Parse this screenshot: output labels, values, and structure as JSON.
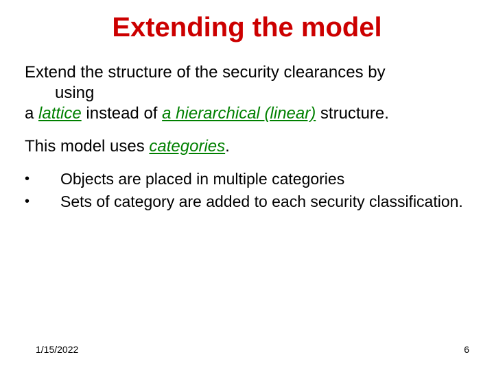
{
  "title": "Extending the model",
  "para1": {
    "line1_pre": "Extend the structure of the security clearances by",
    "line1_indent": "using",
    "line2_pre": "a ",
    "lattice": "lattice",
    "line2_mid": " instead of ",
    "hier": "a hierarchical (linear)",
    "line2_post": " structure."
  },
  "para2": {
    "pre": "This model uses ",
    "cat": "categories",
    "post": "."
  },
  "bullets": [
    "Objects are placed in multiple categories",
    "Sets of category are added to each security classification."
  ],
  "footer": {
    "date": "1/15/2022",
    "page": "6"
  }
}
